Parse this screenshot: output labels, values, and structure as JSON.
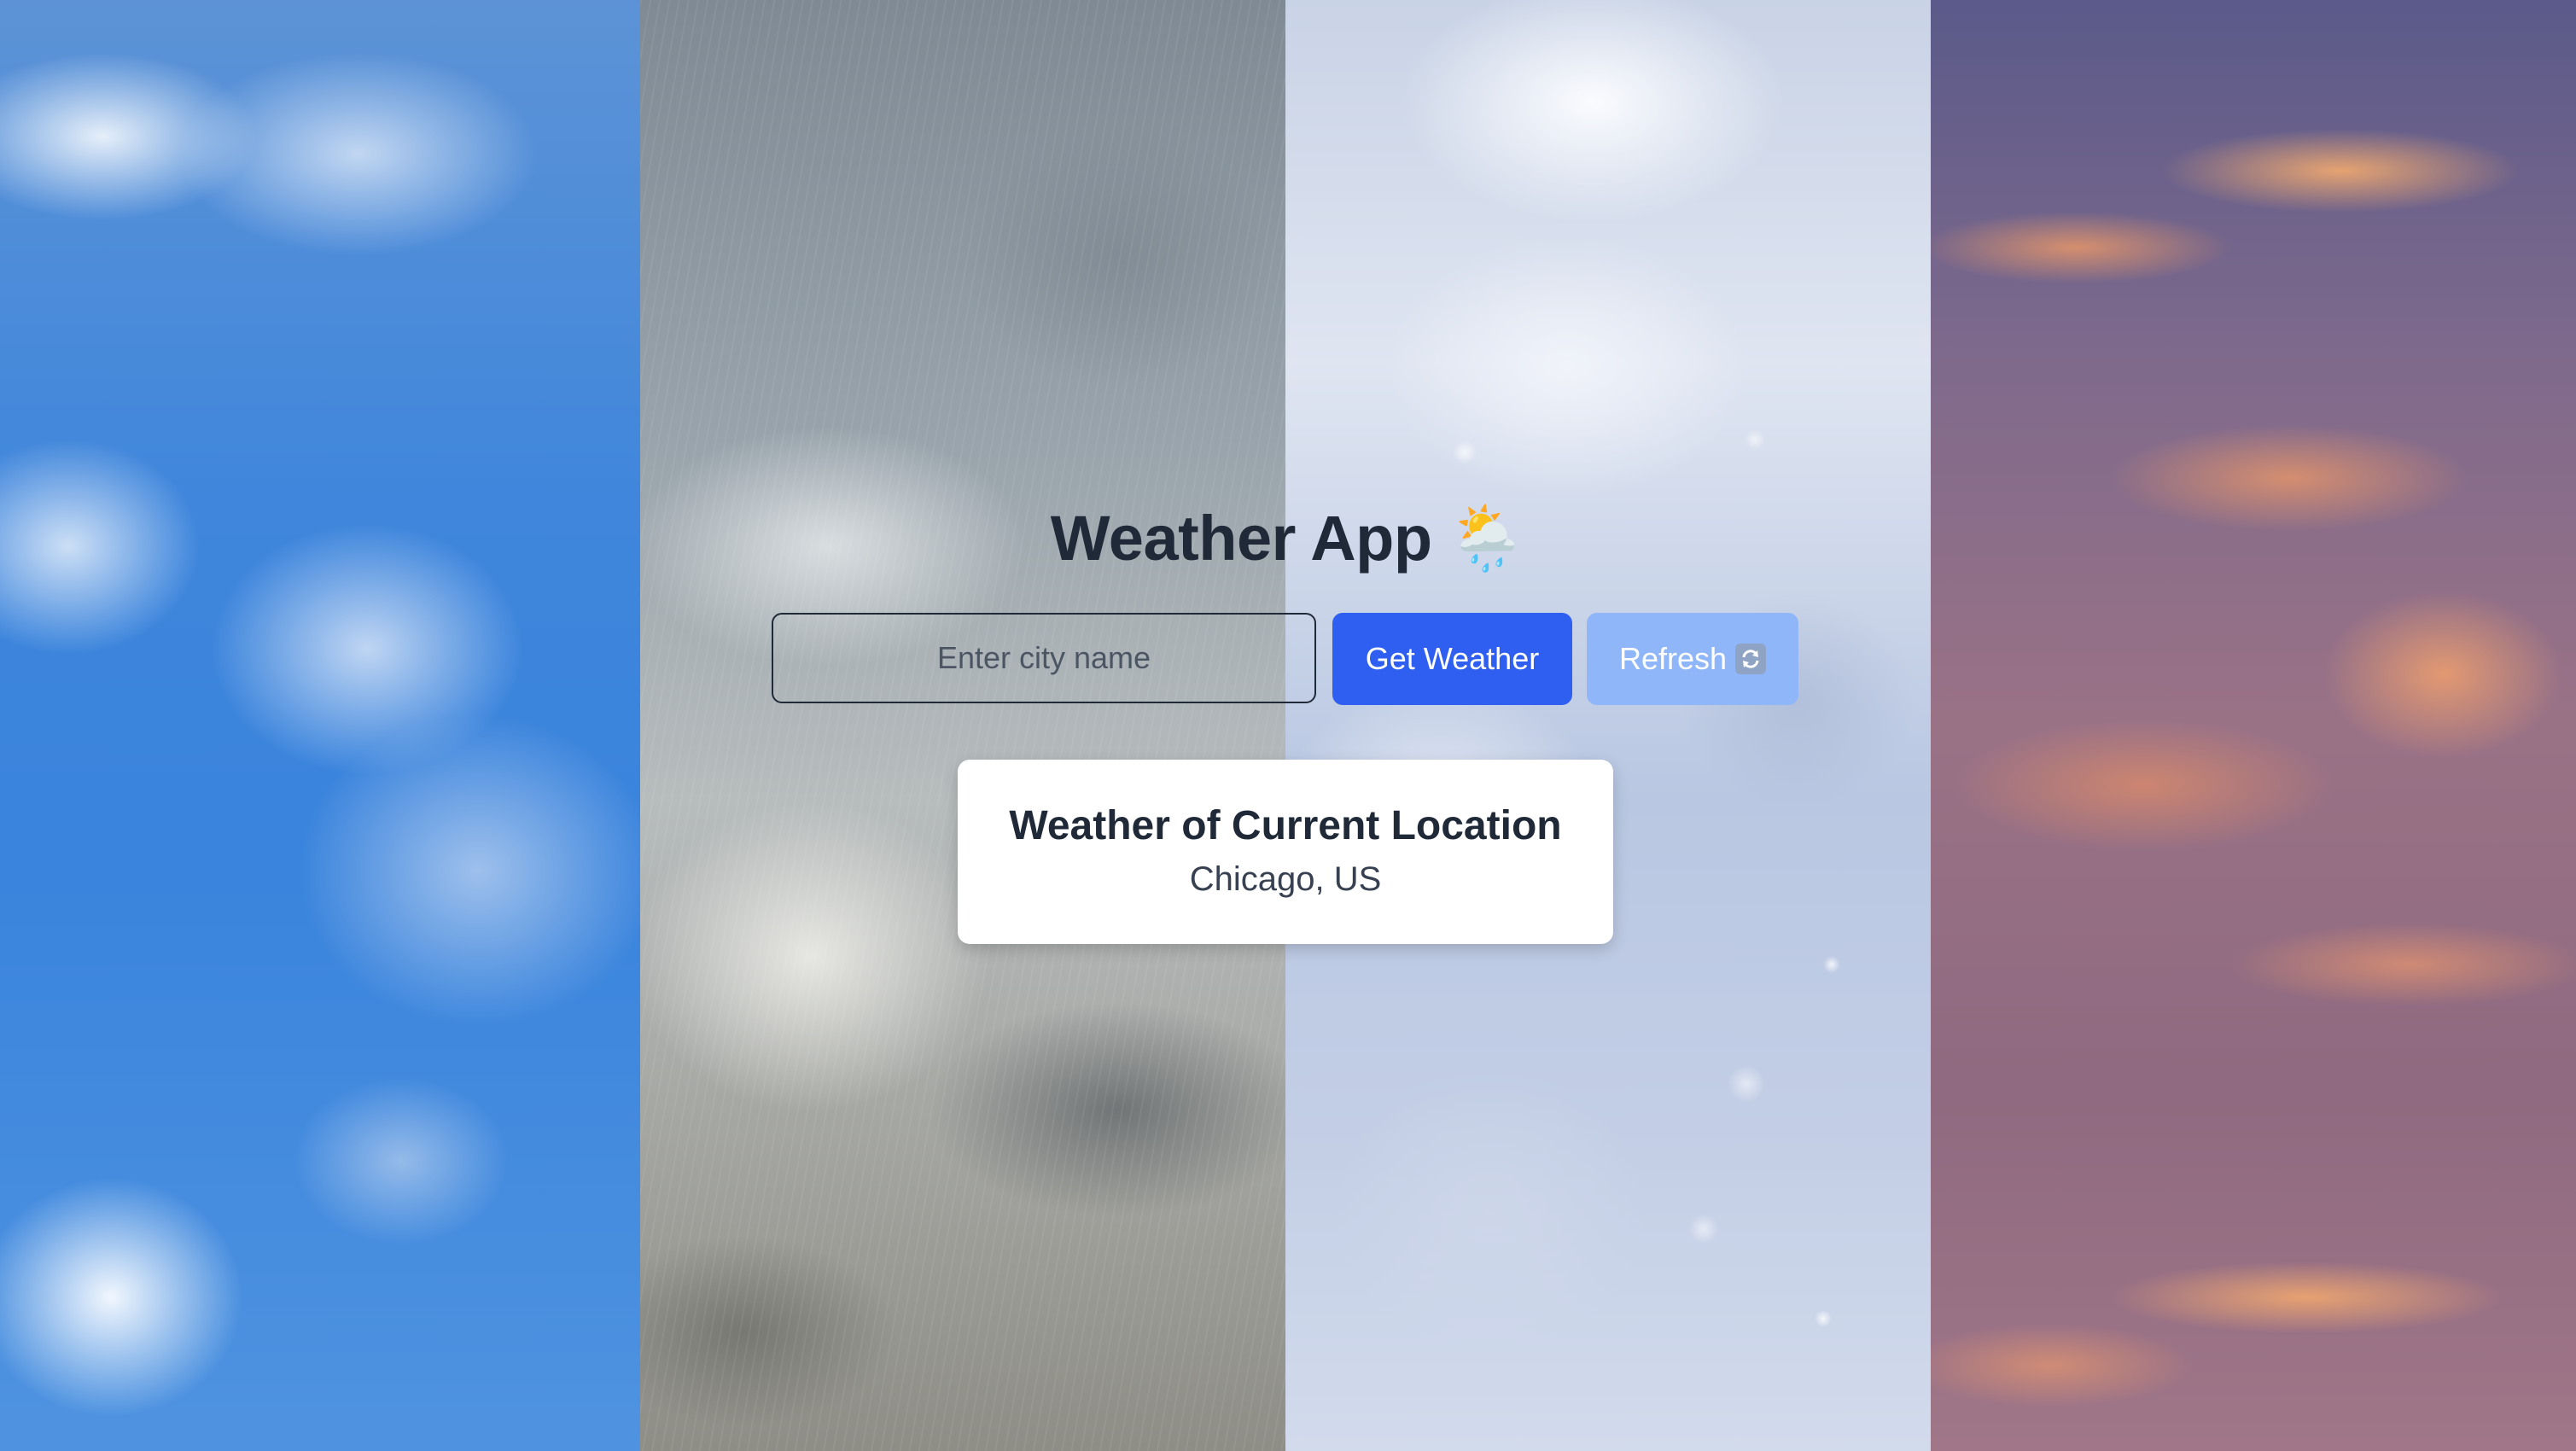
{
  "app": {
    "title": "Weather App",
    "title_emoji": "🌦️"
  },
  "search": {
    "placeholder": "Enter city name",
    "value": ""
  },
  "buttons": {
    "get_weather_label": "Get Weather",
    "refresh_label": "Refresh",
    "refresh_icon": "refresh-icon"
  },
  "current": {
    "heading": "Weather of Current Location",
    "location": "Chicago, US"
  },
  "background_panels": [
    "clear-sky",
    "rain",
    "snow",
    "sunset"
  ],
  "colors": {
    "primary_button": "#2f5ff0",
    "refresh_button": "#8fb6f8",
    "text_dark": "#1f2937"
  }
}
